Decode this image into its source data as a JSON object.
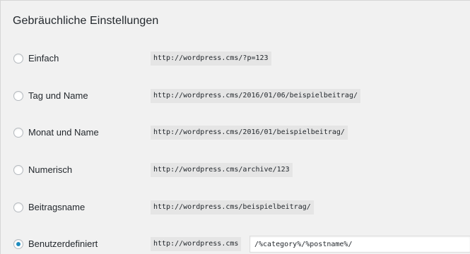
{
  "section": {
    "title": "Gebräuchliche Einstellungen"
  },
  "options": [
    {
      "label": "Einfach",
      "example": "http://wordpress.cms/?p=123",
      "selected": false
    },
    {
      "label": "Tag und Name",
      "example": "http://wordpress.cms/2016/01/06/beispielbeitrag/",
      "selected": false
    },
    {
      "label": "Monat und Name",
      "example": "http://wordpress.cms/2016/01/beispielbeitrag/",
      "selected": false
    },
    {
      "label": "Numerisch",
      "example": "http://wordpress.cms/archive/123",
      "selected": false
    },
    {
      "label": "Beitragsname",
      "example": "http://wordpress.cms/beispielbeitrag/",
      "selected": false
    },
    {
      "label": "Benutzerdefiniert",
      "example": "http://wordpress.cms",
      "selected": true
    }
  ],
  "custom_structure": {
    "value": "/%category%/%postname%/"
  },
  "colors": {
    "radio_selected": "#1e8cbe",
    "code_background": "#e5e5e5",
    "panel_background": "#f1f1f1"
  }
}
